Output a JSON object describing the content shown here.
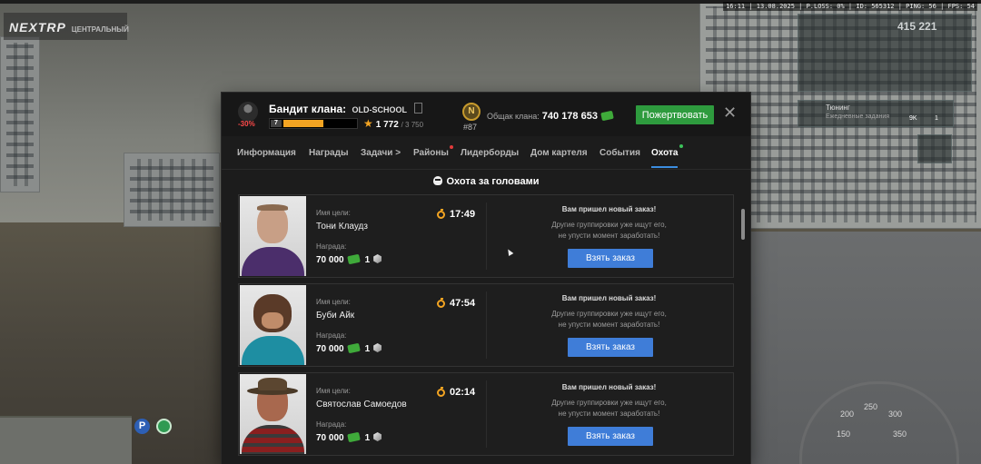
{
  "hud": {
    "logo": "NEXTRP",
    "logo_sub": "ЦЕНТРАЛЬНЫЙ",
    "top_info": "16:11 | 13.08.2025 | P.LOSS: 0% | ID: 565312 | PING: 56 | FPS: 54",
    "score": "415 221",
    "tuning_title": "Тюнинг",
    "tuning_sub": "Ежедневные задания",
    "tuning_val_a": "9K",
    "tuning_val_b": "1",
    "speedo_ticks": [
      "200",
      "250",
      "300",
      "150",
      "350"
    ]
  },
  "dialog": {
    "avatar_discount": "-30%",
    "title_prefix": "Бандит клана:",
    "clan_name": "OLD-SCHOOL",
    "level": "7",
    "xp_fraction": 0.55,
    "stars_value": "1 772",
    "stars_max": "/ 3 750",
    "rank_letter": "N",
    "rank_number": "#87",
    "total_label": "Общак клана:",
    "total_value": "740 178 653",
    "donate_label": "Пожертвовать",
    "close_symbol": "✕",
    "accent_color": "#3f7dd8",
    "success_color": "#2e9b3e",
    "tabs": [
      {
        "label": "Информация"
      },
      {
        "label": "Награды"
      },
      {
        "label": "Задачи >"
      },
      {
        "label": "Районы"
      },
      {
        "label": "Лидерборды"
      },
      {
        "label": "Дом картеля"
      },
      {
        "label": "События"
      },
      {
        "label": "Охота"
      }
    ],
    "active_tab": "Охота",
    "section_title": "Охота за головами",
    "cards": [
      {
        "name_label": "Имя цели:",
        "name": "Тони Клаудз",
        "reward_label": "Награда:",
        "reward_money": "70 000",
        "reward_count": "1",
        "timer": "17:49",
        "notice": "Вам пришел новый заказ!",
        "desc1": "Другие группировки уже ищут его,",
        "desc2": "не упусти момент заработать!",
        "button": "Взять заказ"
      },
      {
        "name_label": "Имя цели:",
        "name": "Буби Айк",
        "reward_label": "Награда:",
        "reward_money": "70 000",
        "reward_count": "1",
        "timer": "47:54",
        "notice": "Вам пришел новый заказ!",
        "desc1": "Другие группировки уже ищут его,",
        "desc2": "не упусти момент заработать!",
        "button": "Взять заказ"
      },
      {
        "name_label": "Имя цели:",
        "name": "Святослав Самоедов",
        "reward_label": "Награда:",
        "reward_money": "70 000",
        "reward_count": "1",
        "timer": "02:14",
        "notice": "Вам пришел новый заказ!",
        "desc1": "Другие группировки уже ищут его,",
        "desc2": "не упусти момент заработать!",
        "button": "Взять заказ"
      }
    ]
  }
}
